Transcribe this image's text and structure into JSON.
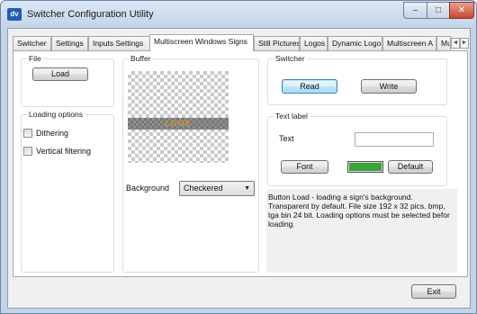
{
  "window": {
    "title": "Switcher Configuration Utility",
    "app_icon_text": "dv",
    "controls": {
      "minimize": "–",
      "maximize": "□",
      "close": "✕"
    }
  },
  "tabs": [
    {
      "label": "Switcher"
    },
    {
      "label": "Settings"
    },
    {
      "label": "Inputs Settings"
    },
    {
      "label": "Multiscreen Windows Signs"
    },
    {
      "label": "Still Pictures"
    },
    {
      "label": "Logos"
    },
    {
      "label": "Dynamic Logo"
    },
    {
      "label": "Multiscreen A"
    },
    {
      "label": "Mult"
    }
  ],
  "active_tab": "Multiscreen Windows Signs",
  "tab_scroll": {
    "left": "◄",
    "right": "►"
  },
  "file_group": {
    "label": "File",
    "load_button": "Load"
  },
  "loading_options": {
    "label": "Loading options",
    "dithering": {
      "label": "Dithering",
      "checked": false
    },
    "vertical_filtering": {
      "label": "Vertical filtering",
      "checked": false
    }
  },
  "buffer_group": {
    "label": "Buffer",
    "preview_text": "LOGE",
    "background_label": "Background",
    "background_value": "Checkered"
  },
  "switcher_group": {
    "label": "Switcher",
    "read_button": "Read",
    "write_button": "Write"
  },
  "text_label_group": {
    "label": "Text label",
    "text_label": "Text",
    "text_value": "",
    "font_button": "Font",
    "default_button": "Default",
    "color": "#37a637"
  },
  "info_text": "Button Load - loading a sign's background. Transparent by default. File size 192 x 32 pics. bmp, tga bin 24 bit. Loading options must be  selected befor loading.",
  "footer": {
    "exit_button": "Exit"
  }
}
